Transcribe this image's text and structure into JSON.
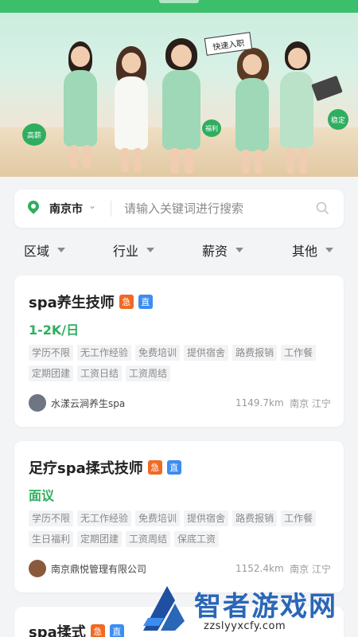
{
  "banner": {
    "sign_text": "快速入职",
    "bubbles": [
      "高薪",
      "福利",
      "稳定"
    ]
  },
  "search": {
    "city": "南京市",
    "placeholder": "请输入关键词进行搜索"
  },
  "filters": [
    "区域",
    "行业",
    "薪资",
    "其他"
  ],
  "jobs": [
    {
      "title": "spa养生技师",
      "badges": [
        "急",
        "直"
      ],
      "salary": "1-2K/日",
      "tags_row1": [
        "学历不限",
        "无工作经验",
        "免费培训",
        "提供宿舍",
        "路费报销"
      ],
      "tags_row2": [
        "工作餐",
        "定期团建",
        "工资日结",
        "工资周结"
      ],
      "company": "水漾云涧养生spa",
      "distance": "1149.7km",
      "location": "南京  江宁"
    },
    {
      "title": "足疗spa揉式技师",
      "badges": [
        "急",
        "直"
      ],
      "salary": "面议",
      "tags_row1": [
        "学历不限",
        "无工作经验",
        "免费培训",
        "提供宿舍",
        "路费报销"
      ],
      "tags_row2": [
        "工作餐",
        "生日福利",
        "定期团建",
        "工资周结",
        "保底工资"
      ],
      "company": "南京鼎悦管理有限公司",
      "distance": "1152.4km",
      "location": "南京  江宁"
    },
    {
      "title": "spa揉式",
      "badges": [
        "急",
        "直"
      ]
    }
  ],
  "watermark": {
    "text": "智者游戏网",
    "url": "zzslyyxcfy.com"
  },
  "colors": {
    "accent": "#2fae5f",
    "urgent": "#f06a24",
    "direct": "#3c8df0"
  }
}
